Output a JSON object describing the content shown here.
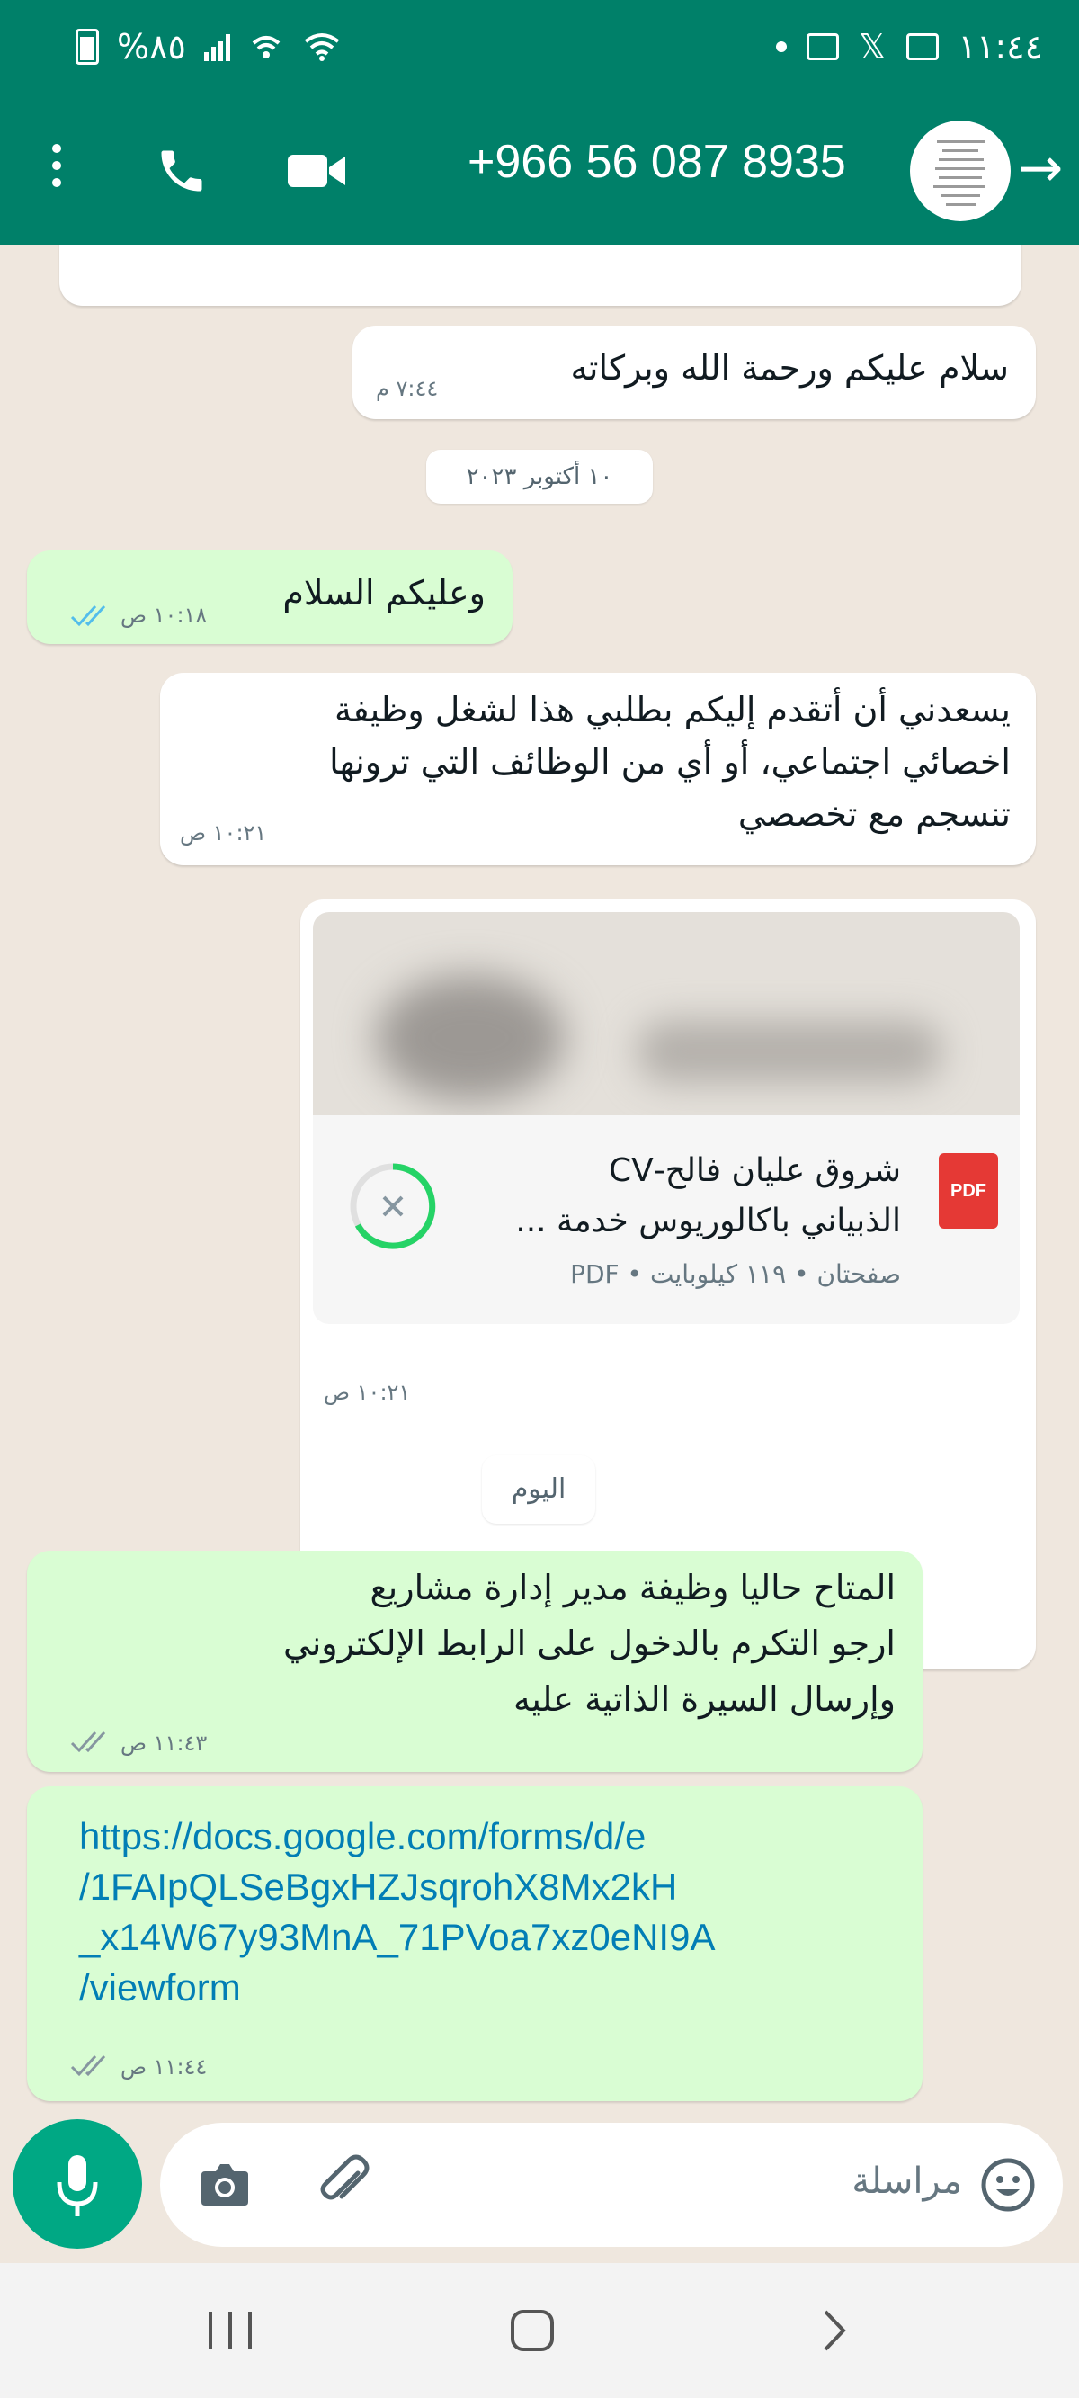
{
  "status_bar": {
    "time": "١١:٤٤",
    "battery": "%٨٥"
  },
  "header": {
    "contact_name": "+966 56 087 8935",
    "icons": [
      "menu-icon",
      "phone-icon",
      "video-icon",
      "back-arrow-icon"
    ]
  },
  "chat": {
    "incoming_1": {
      "text": "سلام عليكم ورحمة الله وبركاته",
      "time": "٧:٤٤ م"
    },
    "date_1": "١٠ أكتوبر ٢٠٢٣",
    "outgoing_1": {
      "text": "وعليكم السلام",
      "time": "١٠:١٨ ص",
      "status": "read"
    },
    "incoming_2": {
      "lines": [
        "يسعدني أن أتقدم إليكم بطلبي هذا لشغل وظيفة",
        "اخصائي اجتماعي، أو أي من الوظائف التي ترونها",
        "تنسجم مع تخصصي"
      ],
      "time": "١٠:٢١ ص"
    },
    "document": {
      "name_lines": [
        "شروق عليان فالح-CV",
        "الذبياني باكالوريوس خدمة ..."
      ],
      "badge": "PDF",
      "meta": "صفحتان • ١١٩ كيلوبايت • PDF",
      "time": "١٠:٢١ ص"
    },
    "date_2": "اليوم",
    "outgoing_2": {
      "lines": [
        "المتاح حاليا وظيفة مدير إدارة مشاريع",
        "ارجو التكرم بالدخول على الرابط الإلكتروني",
        "وإرسال السيرة الذاتية عليه"
      ],
      "time": "١١:٤٣ ص",
      "status": "delivered"
    },
    "outgoing_3": {
      "link_lines": [
        "https://docs.google.com/forms/d/e",
        "/1FAIpQLSeBgxHZJsqrohX8Mx2kH",
        "_x14W67y93MnA_71PVoa7xz0eNI9A",
        "/viewform"
      ],
      "time": "١١:٤٤ ص",
      "status": "delivered"
    }
  },
  "input": {
    "placeholder": "مراسلة"
  },
  "colors": {
    "header": "#008069",
    "accent": "#00a884",
    "outgoing_bubble": "#d9fdd3",
    "link": "#027eb5",
    "read_ticks": "#53bdeb"
  }
}
